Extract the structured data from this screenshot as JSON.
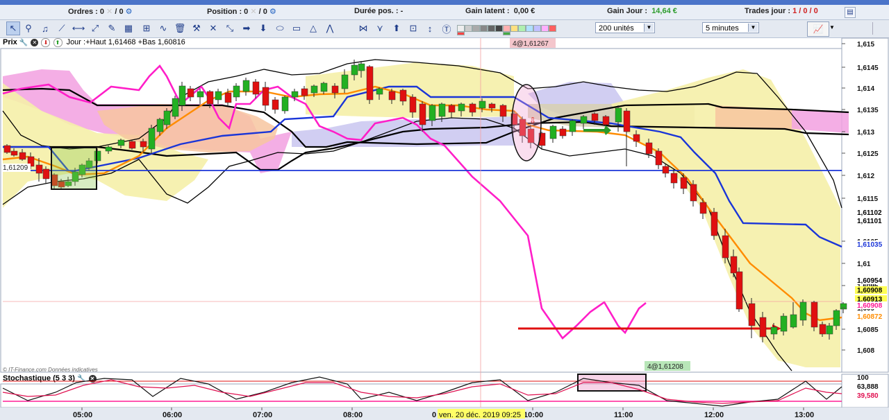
{
  "titlebar": {
    "text": ""
  },
  "infobar": {
    "ordres_label": "Ordres :",
    "ordres_value": "0",
    "ordres_sep": "/",
    "ordres_value2": "0",
    "position_label": "Position :",
    "position_value": "0",
    "position_sep": "/",
    "position_value2": "0",
    "duree_label": "Durée pos. :",
    "duree_value": "-",
    "gain_latent_label": "Gain latent :",
    "gain_latent_value": "0,00 €",
    "gain_jour_label": "Gain Jour :",
    "gain_jour_value": "14,64 €",
    "trades_label": "Trades jour :",
    "trades_value": "1 / 0 / 0"
  },
  "toolbar": {
    "units_select": "200 unités",
    "period_select": "5 minutes"
  },
  "price_panel": {
    "name": "Prix",
    "ohlc": "Jour :+Haut 1,61468 +Bas 1,60816",
    "order_tag_top": "4@1,61267",
    "order_tag_bottom": "4@1,61208",
    "source_note": "© IT-Finance.com  Données indicatives",
    "left_level": "1,61209",
    "axis_labels": [
      "1,615",
      "1,6145",
      "1,614",
      "1,6135",
      "1,613",
      "1,6125",
      "1,612",
      "1,6115",
      "1,6105",
      "1,61",
      "1,6095",
      "1,609",
      "1,6085",
      "1,608"
    ],
    "price_tags": [
      {
        "text": "1,61102",
        "color": "#000000"
      },
      {
        "text": "1,61101",
        "color": "#000000"
      },
      {
        "text": "1,61035",
        "color": "#1a35d8"
      },
      {
        "text": "1,60954",
        "color": "#000000"
      },
      {
        "text": "1,60908",
        "color": "#000000"
      },
      {
        "text": "1,60913",
        "color": "#000000"
      },
      {
        "text": "1,60908",
        "color": "#ff1493"
      },
      {
        "text": "1,60872",
        "color": "#ff8c00"
      }
    ]
  },
  "stoch_panel": {
    "name": "Stochastique (5 3 3)",
    "axis_top": "100",
    "value_k": "63,888",
    "value_d": "39,580"
  },
  "time_axis": {
    "labels": [
      "05:00",
      "06:00",
      "07:00",
      "08:00",
      "10:00",
      "11:00",
      "12:00",
      "13:00"
    ],
    "cursor_label": "ven. 20 déc. 2019 09:25",
    "cursor_prefix": "0"
  },
  "colors": {
    "bull": "#22b022",
    "bear": "#e01010",
    "tenkan": "#1a35d8",
    "kijun": "#ff8c00",
    "chikou": "#ff1ec8",
    "bollinger": "#000000",
    "cloud_pink": "#f2a0e0",
    "cloud_yellow": "#f5f0a8"
  }
}
